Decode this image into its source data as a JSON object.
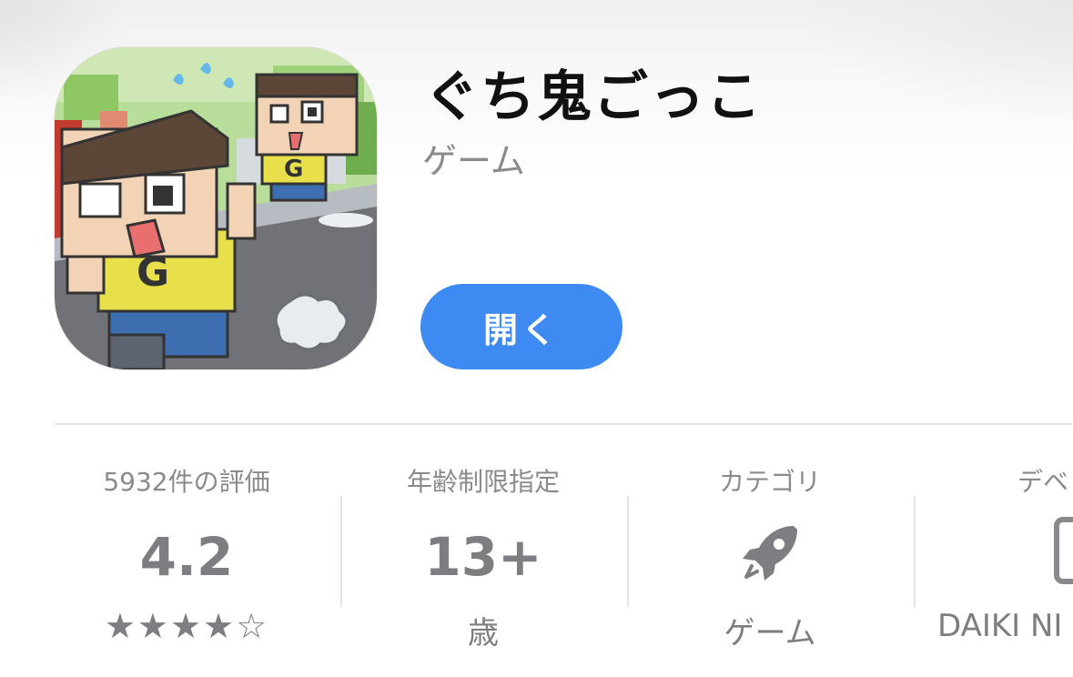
{
  "app": {
    "title": "ぐち鬼ごっこ",
    "subtitle": "ゲーム",
    "open_label": "開く",
    "icon_letter": "G"
  },
  "info": {
    "ratings": {
      "label": "5932件の評価",
      "value": "4.2",
      "stars": "★★★★☆"
    },
    "age": {
      "label": "年齢制限指定",
      "value": "13+",
      "sub": "歳"
    },
    "category": {
      "label": "カテゴリ",
      "icon": "rocket-icon",
      "sub": "ゲーム"
    },
    "developer": {
      "label": "デベ",
      "icon": "phone-icon",
      "sub": "DAIKI NI"
    }
  },
  "colors": {
    "accent": "#3d8bf2",
    "secondary_text": "#8a8a8e",
    "divider": "#e4e4e6"
  }
}
